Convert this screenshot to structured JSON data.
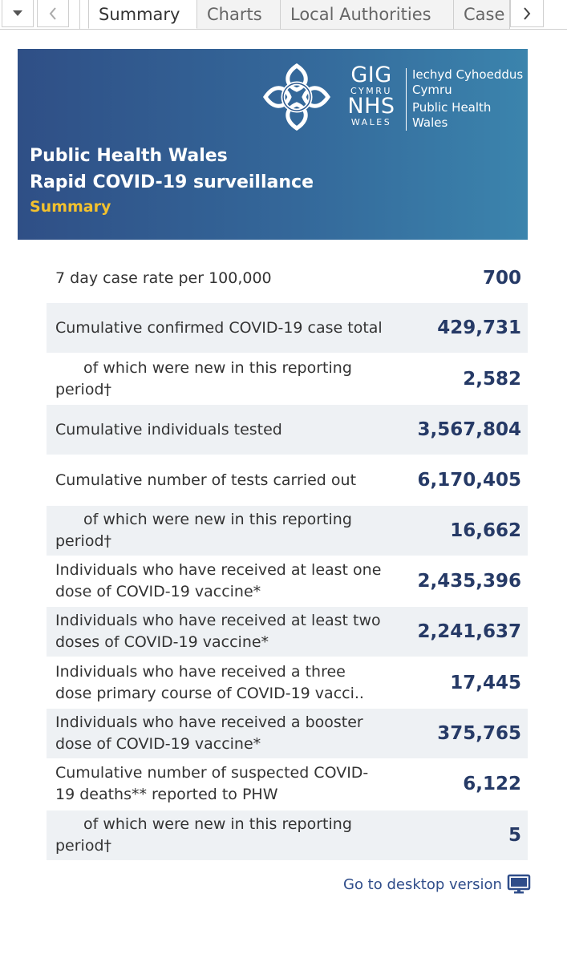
{
  "tabs": {
    "items": [
      "Summary",
      "Charts",
      "Local Authorities",
      "Case"
    ],
    "active": "Summary"
  },
  "banner": {
    "logo_gig": "GIG",
    "logo_cymru": "CYMRU",
    "logo_nhs": "NHS",
    "logo_wales": "WALES",
    "org_welsh_1": "Iechyd Cyhoeddus",
    "org_welsh_2": "Cymru",
    "org_english_1": "Public Health",
    "org_english_2": "Wales",
    "title_line1": "Public Health Wales",
    "title_line2": "Rapid COVID-19 surveillance",
    "subtitle": "Summary"
  },
  "metrics": [
    {
      "label": "7 day case rate per 100,000",
      "value": "700"
    },
    {
      "label": "Cumulative confirmed COVID-19 case total",
      "value": "429,731"
    },
    {
      "label": "of which were new in this reporting period†",
      "value": "2,582"
    },
    {
      "label": "Cumulative individuals tested",
      "value": "3,567,804"
    },
    {
      "label": "Cumulative number of tests carried out",
      "value": "6,170,405"
    },
    {
      "label": "of which were new in this reporting period†",
      "value": "16,662"
    },
    {
      "label": "Individuals who have received at least one dose of COVID-19 vaccine*",
      "value": "2,435,396"
    },
    {
      "label": "Individuals who have received at least two doses of COVID-19 vaccine*",
      "value": "2,241,637"
    },
    {
      "label": "Individuals who have received a three dose primary course of COVID-19 vacci..",
      "value": "17,445"
    },
    {
      "label": "Individuals who have received a booster dose of COVID-19 vaccine*",
      "value": "375,765"
    },
    {
      "label": "Cumulative number of suspected COVID-19 deaths** reported to PHW",
      "value": "6,122"
    },
    {
      "label": "of which were new in this reporting period†",
      "value": "5"
    }
  ],
  "footer": {
    "desktop_link": "Go to desktop version",
    "desktop_icon": "monitor-icon"
  },
  "colors": {
    "banner_start": "#2f4f86",
    "banner_end": "#3b84ad",
    "accent_yellow": "#f2c12e",
    "value_navy": "#263a66",
    "row_shade": "#eef1f4"
  }
}
